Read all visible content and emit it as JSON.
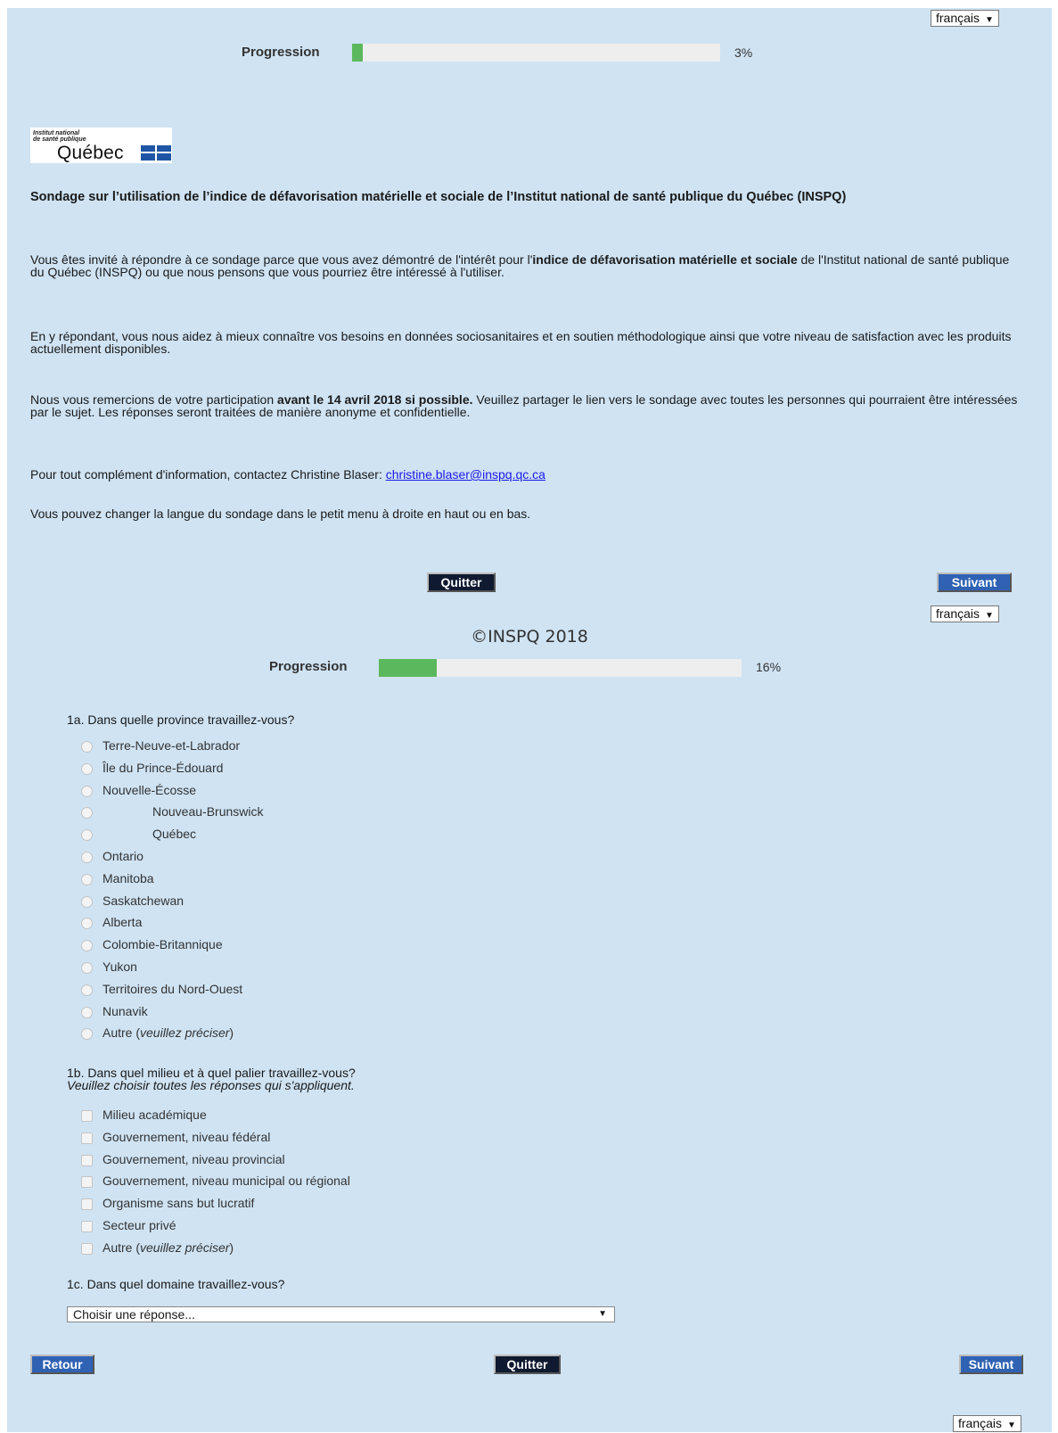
{
  "top": {
    "language": "français",
    "progress_label": "Progression",
    "progress_value": 0.03,
    "progress_text": "3%"
  },
  "logo": {
    "line1": "Institut national",
    "line2": "de santé publique",
    "name": "Québec"
  },
  "intro": {
    "title": "Sondage sur l’utilisation de l’indice de défavorisation matérielle et sociale de l’Institut national de santé publique du Québec (INSPQ)",
    "p1_a": "Vous êtes invité à répondre à ce sondage parce que vous avez démontré de l'intérêt pour l'",
    "p1_bold": "indice de défavorisation matérielle et sociale",
    "p1_b": " de l'Institut national de santé publique du Québec (INSPQ) ou que nous pensons que vous pourriez être intéressé à l'utiliser.",
    "p2": "En y répondant, vous nous aidez à mieux connaître vos besoins en données sociosanitaires et en soutien méthodologique ainsi que votre niveau de satisfaction avec les produits actuellement disponibles.",
    "p3_a": "Nous vous remercions de votre participation ",
    "p3_bold": "avant le 14 avril 2018 si possible.",
    "p3_b": " Veuillez partager le lien vers le sondage avec toutes les personnes qui pourraient être intéressées par le sujet. Les réponses seront traitées de manière anonyme et confidentielle.",
    "p4_a": "Pour tout complément d'information, contactez Christine Blaser: ",
    "p4_link": "christine.blaser@inspq.qc.ca",
    "p5": "Vous pouvez changer la langue du sondage dans le petit menu à droite en haut ou en bas."
  },
  "nav1": {
    "quit": "Quitter",
    "next": "Suivant",
    "language": "français"
  },
  "copyright": "©INSPQ 2018",
  "progress2": {
    "label": "Progression",
    "value": 0.16,
    "text": "16%"
  },
  "q1a": {
    "title": "1a. Dans quelle province travaillez-vous?",
    "options": [
      "Terre-Neuve-et-Labrador",
      "Île du Prince-Édouard",
      "Nouvelle-Écosse",
      "Nouveau-Brunswick",
      "Québec",
      "Ontario",
      "Manitoba",
      "Saskatchewan",
      "Alberta",
      "Colombie-Britannique",
      "Yukon",
      "Territoires du Nord-Ouest",
      "Nunavik"
    ],
    "other_a": "Autre (",
    "other_italic": "veuillez préciser",
    "other_b": ")"
  },
  "q1b": {
    "title": "1b. Dans quel milieu et à quel palier travaillez-vous?",
    "note": "Veuillez choisir toutes les réponses qui s'appliquent.",
    "options": [
      "Milieu académique",
      "Gouvernement, niveau fédéral",
      "Gouvernement, niveau provincial",
      "Gouvernement, niveau municipal ou régional",
      "Organisme sans but lucratif",
      "Secteur privé"
    ],
    "other_a": "Autre (",
    "other_italic": "veuillez préciser",
    "other_b": ")"
  },
  "q1c": {
    "title": "1c. Dans quel domaine travaillez-vous?",
    "placeholder": "Choisir une réponse..."
  },
  "nav2": {
    "back": "Retour",
    "quit": "Quitter",
    "next": "Suivant",
    "language": "français"
  },
  "colors": {
    "background": "#cfe3f3",
    "progress_fill": "#5cb85c",
    "button_dark": "#0f1a30",
    "button_blue": "#2f62b3",
    "link": "#1a1aee"
  }
}
